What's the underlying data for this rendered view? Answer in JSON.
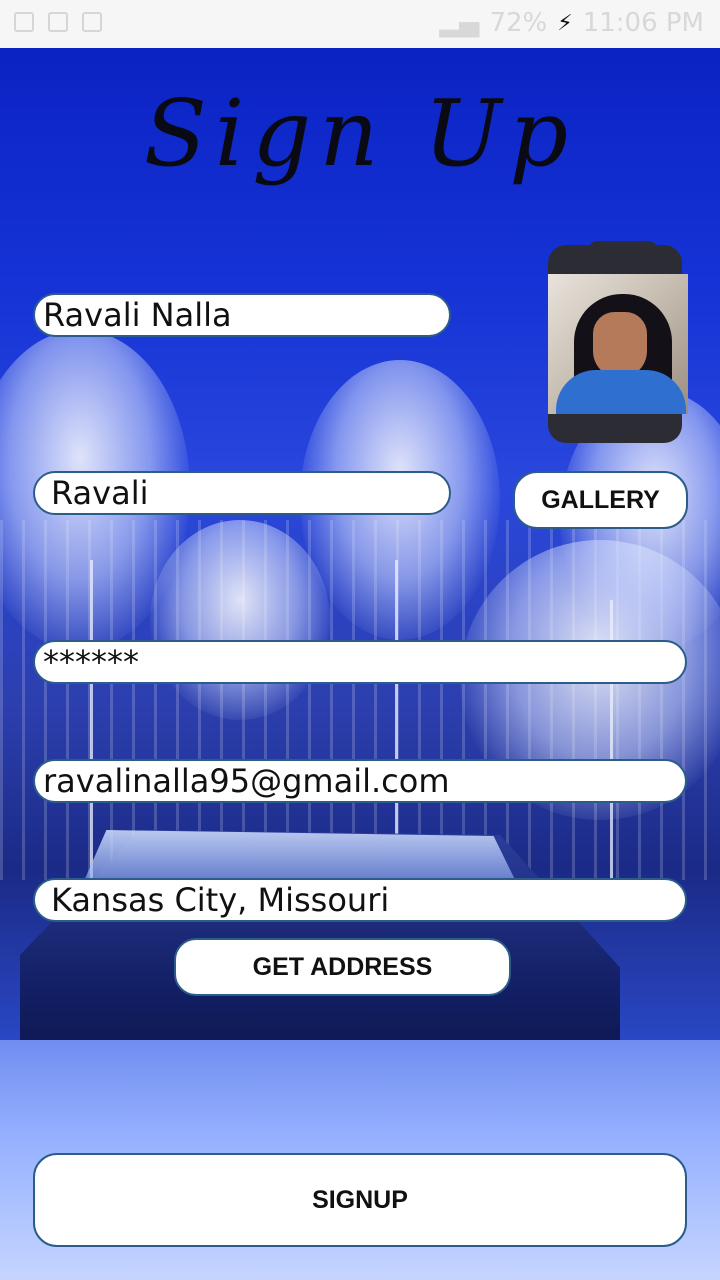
{
  "status_bar": {
    "battery": "72%",
    "time": "11:06 PM",
    "icons": [
      "image-icon",
      "file-icon",
      "file-delete-icon",
      "signal-icon",
      "charging-icon"
    ]
  },
  "page": {
    "title": "Sign Up"
  },
  "form": {
    "name_value": "Ravali Nalla",
    "username_value": "Ravali",
    "password_value": "******",
    "email_value": "ravalinalla95@gmail.com",
    "address_value": "Kansas City, Missouri"
  },
  "buttons": {
    "gallery": "GALLERY",
    "get_address": "GET ADDRESS",
    "signup": "SIGNUP"
  },
  "colors": {
    "field_border": "#2b5c8a",
    "background_blue": "#1533d6"
  }
}
